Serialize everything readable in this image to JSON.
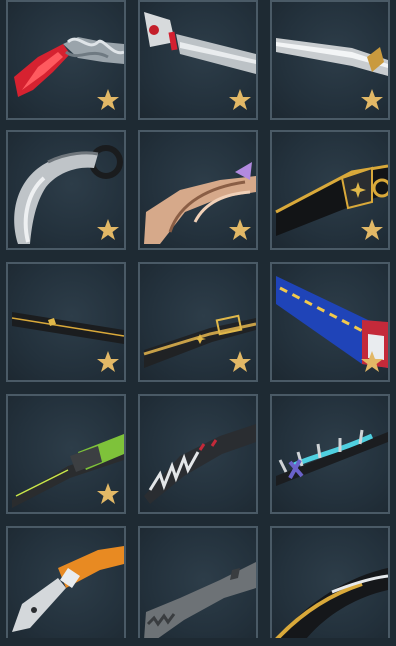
{
  "colors": {
    "tile_bg": "#23313c",
    "tile_border": "#4a5a66",
    "favorite_star": "#e2b866",
    "page_bg": "#1e2a33"
  },
  "tiles": [
    {
      "id": "skin-1",
      "icon": "red-crystal-knife-icon",
      "favorite": true
    },
    {
      "id": "skin-2",
      "icon": "white-red-blade-icon",
      "favorite": true
    },
    {
      "id": "skin-3",
      "icon": "silver-gold-blade-icon",
      "favorite": true
    },
    {
      "id": "skin-4",
      "icon": "silver-karambit-icon",
      "favorite": true
    },
    {
      "id": "skin-5",
      "icon": "gold-ornate-blade-icon",
      "favorite": true
    },
    {
      "id": "skin-6",
      "icon": "black-gold-blade-icon",
      "favorite": true
    },
    {
      "id": "skin-7",
      "icon": "dark-gold-knife-icon",
      "favorite": true
    },
    {
      "id": "skin-8",
      "icon": "black-gold-dagger-icon",
      "favorite": true
    },
    {
      "id": "skin-9",
      "icon": "blue-energy-blade-icon",
      "favorite": true
    },
    {
      "id": "skin-10",
      "icon": "green-tech-blade-icon",
      "favorite": true
    },
    {
      "id": "skin-11",
      "icon": "spiked-dark-blade-icon",
      "favorite": false
    },
    {
      "id": "skin-12",
      "icon": "spiked-cyan-blade-icon",
      "favorite": false
    },
    {
      "id": "skin-13",
      "icon": "orange-cleaver-icon",
      "favorite": false
    },
    {
      "id": "skin-14",
      "icon": "gray-combat-knife-icon",
      "favorite": false
    },
    {
      "id": "skin-15",
      "icon": "black-gold-curve-icon",
      "favorite": false
    }
  ]
}
